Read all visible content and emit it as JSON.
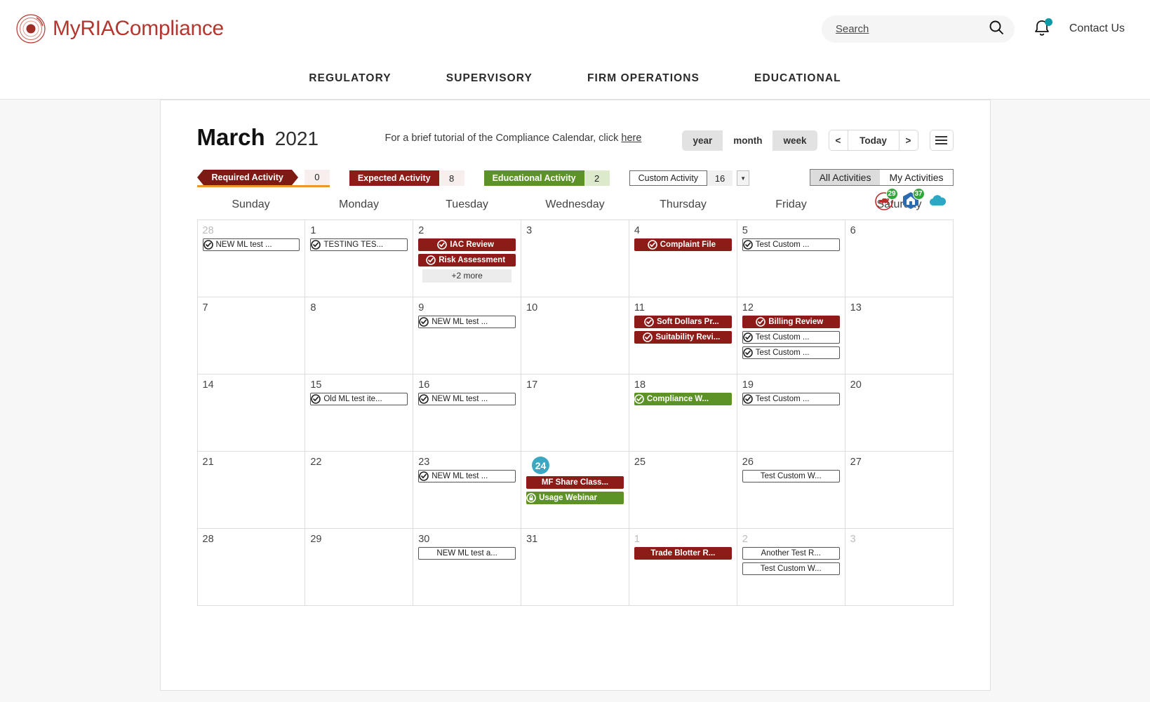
{
  "brand": {
    "name_part1": "MyRIA",
    "name_part2": "Compliance",
    "color": "#b3372f"
  },
  "header": {
    "search_placeholder": "Search",
    "search_value": "",
    "contact_label": "Contact Us"
  },
  "nav": {
    "items": [
      "REGULATORY",
      "SUPERVISORY",
      "FIRM OPERATIONS",
      "EDUCATIONAL"
    ]
  },
  "calendar": {
    "month": "March",
    "year": "2021",
    "tutorial_text": "For a brief tutorial of the Compliance Calendar, click ",
    "tutorial_link": "here",
    "views": [
      {
        "label": "year",
        "active": false
      },
      {
        "label": "month",
        "active": true
      },
      {
        "label": "week",
        "active": false
      }
    ],
    "nav_prev": "<",
    "nav_today": "Today",
    "nav_next": ">",
    "menu_icon": "hamburger-icon",
    "legend": [
      {
        "label": "Required Activity",
        "count": "0",
        "type": "required"
      },
      {
        "label": "Expected Activity",
        "count": "8",
        "type": "expected"
      },
      {
        "label": "Educational Activity",
        "count": "2",
        "type": "educational"
      },
      {
        "label": "Custom Activity",
        "count": "16",
        "type": "custom"
      }
    ],
    "activity_scope": [
      {
        "label": "All Activities",
        "active": true
      },
      {
        "label": "My Activities",
        "active": false
      }
    ],
    "integrations": [
      {
        "name": "redtail-dog-icon",
        "badge": "29",
        "color": "#c02a2a"
      },
      {
        "name": "hexagon-home-icon",
        "badge": "37",
        "color": "#2b6cb0"
      },
      {
        "name": "salesforce-cloud-icon",
        "badge": "",
        "color": "#2ba8c4"
      }
    ],
    "weekdays": [
      "Sunday",
      "Monday",
      "Tuesday",
      "Wednesday",
      "Thursday",
      "Friday",
      "Saturday"
    ],
    "today_day": "24",
    "days": [
      {
        "num": "28",
        "other": true,
        "today": false,
        "events": [
          {
            "title": "NEW ML test ...",
            "kind": "cus",
            "icon": "check-circle-icon"
          }
        ],
        "more": ""
      },
      {
        "num": "1",
        "other": false,
        "today": false,
        "events": [
          {
            "title": "TESTING TES...",
            "kind": "cus",
            "icon": "check-circle-icon"
          }
        ],
        "more": ""
      },
      {
        "num": "2",
        "other": false,
        "today": false,
        "events": [
          {
            "title": "IAC Review",
            "kind": "exp",
            "icon": "check-circle-icon"
          },
          {
            "title": "Risk Assessment",
            "kind": "exp",
            "icon": "check-circle-icon"
          }
        ],
        "more": "+2 more"
      },
      {
        "num": "3",
        "other": false,
        "today": false,
        "events": [],
        "more": ""
      },
      {
        "num": "4",
        "other": false,
        "today": false,
        "events": [
          {
            "title": "Complaint File",
            "kind": "exp",
            "icon": "check-circle-icon"
          }
        ],
        "more": ""
      },
      {
        "num": "5",
        "other": false,
        "today": false,
        "events": [
          {
            "title": "Test Custom ...",
            "kind": "cus",
            "icon": "check-circle-icon"
          }
        ],
        "more": ""
      },
      {
        "num": "6",
        "other": false,
        "today": false,
        "events": [],
        "more": ""
      },
      {
        "num": "7",
        "other": false,
        "today": false,
        "events": [],
        "more": ""
      },
      {
        "num": "8",
        "other": false,
        "today": false,
        "events": [],
        "more": ""
      },
      {
        "num": "9",
        "other": false,
        "today": false,
        "events": [
          {
            "title": "NEW ML test ...",
            "kind": "cus",
            "icon": "check-circle-icon"
          }
        ],
        "more": ""
      },
      {
        "num": "10",
        "other": false,
        "today": false,
        "events": [],
        "more": ""
      },
      {
        "num": "11",
        "other": false,
        "today": false,
        "events": [
          {
            "title": "Soft Dollars Pr...",
            "kind": "exp",
            "icon": "check-circle-icon"
          },
          {
            "title": "Suitability Revi...",
            "kind": "exp",
            "icon": "check-circle-icon"
          }
        ],
        "more": ""
      },
      {
        "num": "12",
        "other": false,
        "today": false,
        "events": [
          {
            "title": "Billing Review",
            "kind": "exp",
            "icon": "check-circle-icon"
          },
          {
            "title": "Test Custom ...",
            "kind": "cus",
            "icon": "check-circle-icon"
          },
          {
            "title": "Test Custom ...",
            "kind": "cus",
            "icon": "check-circle-icon"
          }
        ],
        "more": ""
      },
      {
        "num": "13",
        "other": false,
        "today": false,
        "events": [],
        "more": ""
      },
      {
        "num": "14",
        "other": false,
        "today": false,
        "events": [],
        "more": ""
      },
      {
        "num": "15",
        "other": false,
        "today": false,
        "events": [
          {
            "title": "Old ML test ite...",
            "kind": "cus",
            "icon": "check-circle-icon"
          }
        ],
        "more": ""
      },
      {
        "num": "16",
        "other": false,
        "today": false,
        "events": [
          {
            "title": "NEW ML test ...",
            "kind": "cus",
            "icon": "check-circle-icon"
          }
        ],
        "more": ""
      },
      {
        "num": "17",
        "other": false,
        "today": false,
        "events": [],
        "more": ""
      },
      {
        "num": "18",
        "other": false,
        "today": false,
        "events": [
          {
            "title": "Compliance W...",
            "kind": "edu",
            "icon": "check-circle-icon"
          }
        ],
        "more": ""
      },
      {
        "num": "19",
        "other": false,
        "today": false,
        "events": [
          {
            "title": "Test Custom ...",
            "kind": "cus",
            "icon": "check-circle-icon"
          }
        ],
        "more": ""
      },
      {
        "num": "20",
        "other": false,
        "today": false,
        "events": [],
        "more": ""
      },
      {
        "num": "21",
        "other": false,
        "today": false,
        "events": [],
        "more": ""
      },
      {
        "num": "22",
        "other": false,
        "today": false,
        "events": [],
        "more": ""
      },
      {
        "num": "23",
        "other": false,
        "today": false,
        "events": [
          {
            "title": "NEW ML test ...",
            "kind": "cus",
            "icon": "check-circle-icon"
          }
        ],
        "more": ""
      },
      {
        "num": "24",
        "other": false,
        "today": true,
        "events": [
          {
            "title": "MF Share Class...",
            "kind": "exp",
            "icon": ""
          },
          {
            "title": "Usage Webinar",
            "kind": "edu",
            "icon": "lock-circle-icon"
          }
        ],
        "more": ""
      },
      {
        "num": "25",
        "other": false,
        "today": false,
        "events": [],
        "more": ""
      },
      {
        "num": "26",
        "other": false,
        "today": false,
        "events": [
          {
            "title": "Test Custom W...",
            "kind": "cus",
            "icon": ""
          }
        ],
        "more": ""
      },
      {
        "num": "27",
        "other": false,
        "today": false,
        "events": [],
        "more": ""
      },
      {
        "num": "28",
        "other": false,
        "today": false,
        "events": [],
        "more": ""
      },
      {
        "num": "29",
        "other": false,
        "today": false,
        "events": [],
        "more": ""
      },
      {
        "num": "30",
        "other": false,
        "today": false,
        "events": [
          {
            "title": "NEW ML test a...",
            "kind": "cus",
            "icon": ""
          }
        ],
        "more": ""
      },
      {
        "num": "31",
        "other": false,
        "today": false,
        "events": [],
        "more": ""
      },
      {
        "num": "1",
        "other": true,
        "today": false,
        "events": [
          {
            "title": "Trade Blotter R...",
            "kind": "exp",
            "icon": ""
          }
        ],
        "more": ""
      },
      {
        "num": "2",
        "other": true,
        "today": false,
        "events": [
          {
            "title": "Another Test R...",
            "kind": "cus",
            "icon": ""
          },
          {
            "title": "Test Custom W...",
            "kind": "cus",
            "icon": ""
          }
        ],
        "more": ""
      },
      {
        "num": "3",
        "other": true,
        "today": false,
        "events": [],
        "more": ""
      }
    ]
  }
}
